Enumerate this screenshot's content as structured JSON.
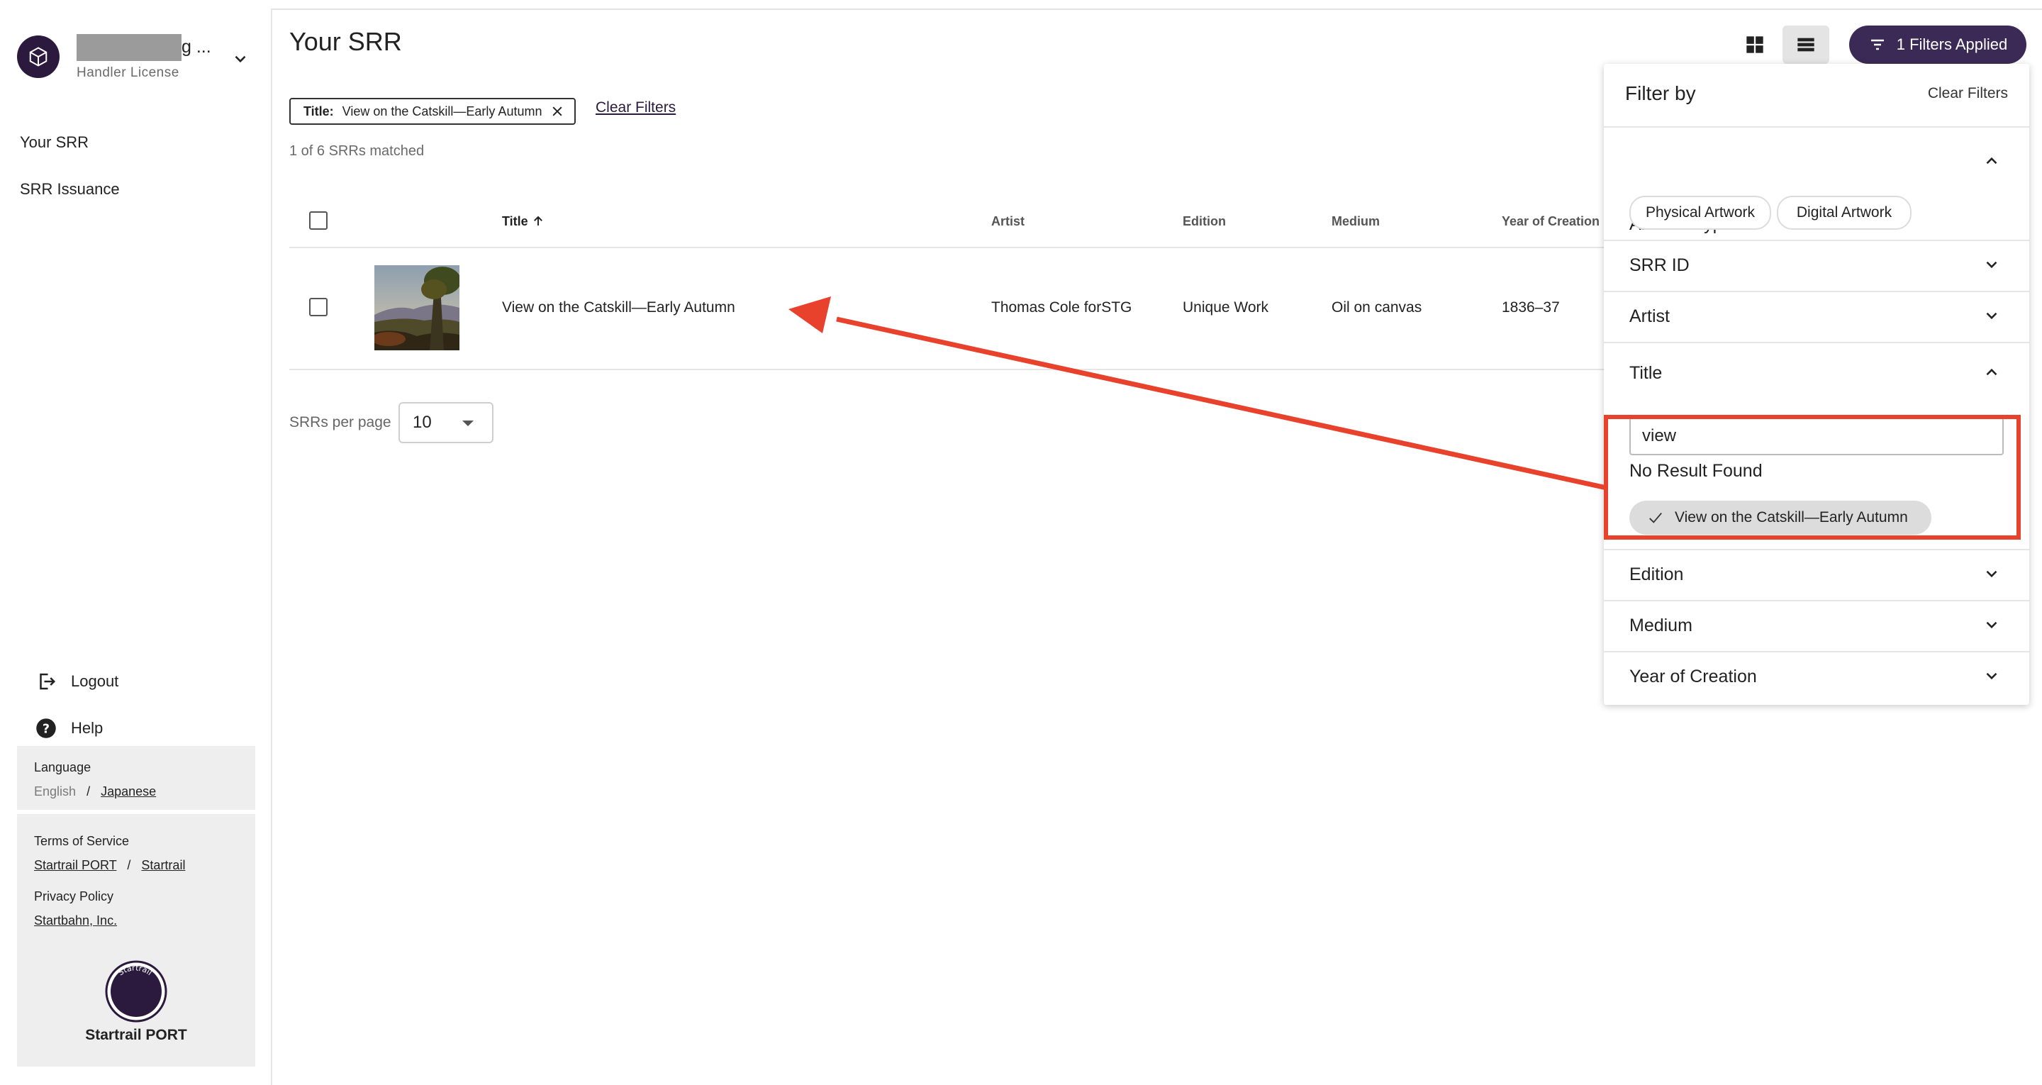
{
  "sidebar": {
    "account": {
      "name": "g ...",
      "license": "Handler License"
    },
    "nav": [
      {
        "label": "Your SRR"
      },
      {
        "label": "SRR Issuance"
      }
    ],
    "logout": "Logout",
    "help": "Help",
    "language": {
      "title": "Language",
      "current": "English",
      "separator": "/",
      "other": "Japanese"
    },
    "terms": {
      "title": "Terms of Service",
      "link1": "Startrail PORT",
      "separator": "/",
      "link2": "Startrail"
    },
    "privacy": {
      "title": "Privacy Policy",
      "link": "Startbahn, Inc."
    },
    "brand": {
      "name": "Startrail PORT",
      "logo_text": "Startrail"
    }
  },
  "main": {
    "page_title": "Your SRR",
    "active_filter": {
      "label": "Title:",
      "value": "View on the Catskill—Early Autumn"
    },
    "clear_filters": "Clear Filters",
    "match_count": "1 of 6 SRRs matched",
    "table": {
      "columns": [
        "Title",
        "Artist",
        "Edition",
        "Medium",
        "Year of Creation"
      ],
      "rows": [
        {
          "title": "View on the Catskill—Early Autumn",
          "artist": "Thomas Cole forSTG",
          "edition": "Unique Work",
          "medium": "Oil on canvas",
          "year": "1836–37"
        }
      ]
    },
    "per_page_label": "SRRs per page",
    "per_page_value": "10"
  },
  "toolbar": {
    "filters_applied": "1 Filters Applied",
    "grid_icon": "grid-view-icon",
    "list_icon": "list-view-icon",
    "accent": "#3b2a55"
  },
  "filter_panel": {
    "title": "Filter by",
    "clear": "Clear Filters",
    "sections": {
      "artwork_type": "Artwork Type",
      "srr_id": "SRR ID",
      "artist": "Artist",
      "title": "Title",
      "edition": "Edition",
      "medium": "Medium",
      "year": "Year of Creation"
    },
    "artwork_type_options": [
      "Physical Artwork",
      "Digital Artwork"
    ],
    "title_search_value": "view",
    "no_result": "No Result Found",
    "selected_title": "View on the Catskill—Early Autumn"
  },
  "annotation": {
    "color": "#e8412c"
  }
}
